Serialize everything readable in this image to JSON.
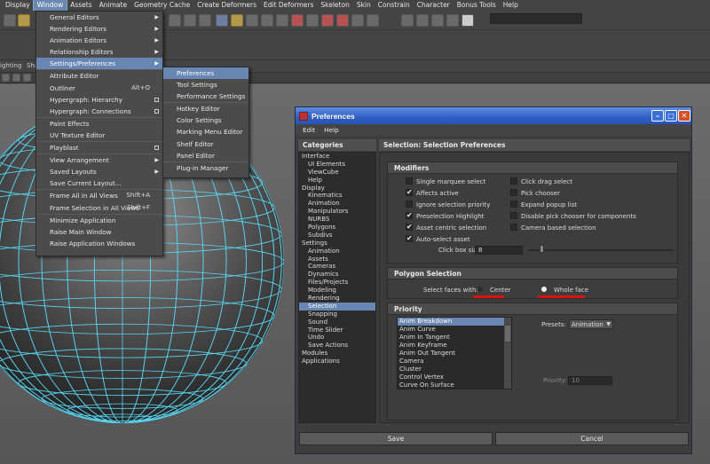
{
  "menubar": [
    "Display",
    "Window",
    "Assets",
    "Animate",
    "Geometry Cache",
    "Create Deformers",
    "Edit Deformers",
    "Skeleton",
    "Skin",
    "Constrain",
    "Character",
    "Bonus Tools",
    "Help"
  ],
  "menubar_active": "Window",
  "shelf_row3": [
    "ighting",
    "Sha"
  ],
  "window_menu": [
    {
      "label": "General Editors",
      "arrow": true
    },
    {
      "label": "Rendering Editors",
      "arrow": true
    },
    {
      "label": "Animation Editors",
      "arrow": true
    },
    {
      "label": "Relationship Editors",
      "arrow": true
    },
    {
      "label": "Settings/Preferences",
      "arrow": true,
      "highlight": true
    },
    {
      "label": "Attribute Editor"
    },
    {
      "label": "Outliner",
      "shortcut": "Alt+O"
    },
    {
      "label": "Hypergraph: Hierarchy",
      "option": true
    },
    {
      "label": "Hypergraph: Connections",
      "option": true
    },
    {
      "label": "Paint Effects"
    },
    {
      "label": "UV Texture Editor"
    },
    {
      "label": "Playblast",
      "option": true
    },
    {
      "label": "View Arrangement",
      "arrow": true
    },
    {
      "label": "Saved Layouts",
      "arrow": true
    },
    {
      "label": "Save Current Layout..."
    },
    {
      "label": "Frame All in All Views",
      "shortcut": "Shift+A"
    },
    {
      "label": "Frame Selection in All Views",
      "shortcut": "Shift+F"
    },
    {
      "label": "Minimize Application"
    },
    {
      "label": "Raise Main Window"
    },
    {
      "label": "Raise Application Windows"
    }
  ],
  "settings_submenu": [
    {
      "label": "Preferences",
      "highlight": true
    },
    {
      "label": "Tool Settings"
    },
    {
      "label": "Performance Settings"
    },
    {
      "label": "Hotkey Editor"
    },
    {
      "label": "Color Settings"
    },
    {
      "label": "Marking Menu Editor"
    },
    {
      "label": "Shelf Editor"
    },
    {
      "label": "Panel Editor"
    },
    {
      "label": "Plug-in Manager"
    }
  ],
  "prefs": {
    "title": "Preferences",
    "menu": [
      "Edit",
      "Help"
    ],
    "categories_header": "Categories",
    "panel_header": "Selection: Selection Preferences",
    "categories": [
      {
        "label": "Interface",
        "sub": false
      },
      {
        "label": "UI Elements",
        "sub": true
      },
      {
        "label": "ViewCube",
        "sub": true
      },
      {
        "label": "Help",
        "sub": true
      },
      {
        "label": "Display",
        "sub": false
      },
      {
        "label": "Kinematics",
        "sub": true
      },
      {
        "label": "Animation",
        "sub": true
      },
      {
        "label": "Manipulators",
        "sub": true
      },
      {
        "label": "NURBS",
        "sub": true
      },
      {
        "label": "Polygons",
        "sub": true
      },
      {
        "label": "Subdivs",
        "sub": true
      },
      {
        "label": "Settings",
        "sub": false
      },
      {
        "label": "Animation",
        "sub": true
      },
      {
        "label": "Assets",
        "sub": true
      },
      {
        "label": "Cameras",
        "sub": true
      },
      {
        "label": "Dynamics",
        "sub": true
      },
      {
        "label": "Files/Projects",
        "sub": true
      },
      {
        "label": "Modeling",
        "sub": true
      },
      {
        "label": "Rendering",
        "sub": true
      },
      {
        "label": "Selection",
        "sub": true,
        "selected": true
      },
      {
        "label": "Snapping",
        "sub": true
      },
      {
        "label": "Sound",
        "sub": true
      },
      {
        "label": "Time Slider",
        "sub": true
      },
      {
        "label": "Undo",
        "sub": true
      },
      {
        "label": "Save Actions",
        "sub": true
      },
      {
        "label": "Modules",
        "sub": false
      },
      {
        "label": "Applications",
        "sub": false
      }
    ],
    "modifiers": {
      "header": "Modifiers",
      "left": [
        {
          "label": "Single marquee select",
          "checked": false
        },
        {
          "label": "Affects active",
          "checked": true
        },
        {
          "label": "Ignore selection priority",
          "checked": false
        },
        {
          "label": "Preselection Highlight",
          "checked": true
        },
        {
          "label": "Asset centric selection",
          "checked": true
        },
        {
          "label": "Auto-select asset",
          "checked": true
        }
      ],
      "right": [
        {
          "label": "Click drag select",
          "checked": false
        },
        {
          "label": "Pick chooser",
          "checked": false
        },
        {
          "label": "Expand popup list",
          "checked": false
        },
        {
          "label": "Disable pick chooser for components",
          "checked": false
        },
        {
          "label": "Camera based selection",
          "checked": false
        }
      ],
      "click_box_label": "Click box size:",
      "click_box_value": "8",
      "click_box_slider": 0.1
    },
    "polygon": {
      "header": "Polygon Selection",
      "label": "Select faces with:",
      "options": [
        {
          "label": "Center",
          "selected": false
        },
        {
          "label": "Whole face",
          "selected": true
        }
      ],
      "annotation_color": "#e01010"
    },
    "priority": {
      "header": "Priority",
      "items": [
        "Anim Breakdown",
        "Anim Curve",
        "Anim In Tangent",
        "Anim Keyframe",
        "Anim Out Tangent",
        "Camera",
        "Cluster",
        "Control Vertex",
        "Curve On Surface"
      ],
      "selected": "Anim Breakdown",
      "presets_label": "Presets:",
      "presets_value": "Animation",
      "priority_label": "Priority:",
      "priority_value": "10"
    },
    "save_label": "Save",
    "cancel_label": "Cancel",
    "title_color": "#2f5ec2"
  }
}
